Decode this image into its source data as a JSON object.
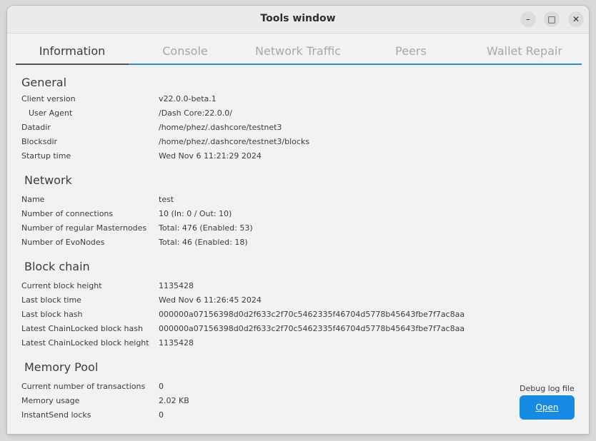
{
  "window": {
    "title": "Tools window",
    "minimize_glyph": "–",
    "maximize_glyph": "□",
    "close_glyph": "✕"
  },
  "tabs": [
    {
      "label": "Information",
      "active": true
    },
    {
      "label": "Console",
      "active": false
    },
    {
      "label": "Network Traffic",
      "active": false
    },
    {
      "label": "Peers",
      "active": false
    },
    {
      "label": "Wallet Repair",
      "active": false
    }
  ],
  "general": {
    "title": "General",
    "rows": [
      {
        "label": "Client version",
        "value": "v22.0.0-beta.1"
      },
      {
        "label": "User Agent",
        "value": "/Dash Core:22.0.0/"
      },
      {
        "label": "Datadir",
        "value": "/home/phez/.dashcore/testnet3"
      },
      {
        "label": "Blocksdir",
        "value": "/home/phez/.dashcore/testnet3/blocks"
      },
      {
        "label": "Startup time",
        "value": "Wed Nov 6 11:21:29 2024"
      }
    ]
  },
  "network": {
    "title": "Network",
    "rows": [
      {
        "label": "Name",
        "value": "test"
      },
      {
        "label": "Number of connections",
        "value": "10 (In: 0 / Out: 10)"
      },
      {
        "label": "Number of regular Masternodes",
        "value": "Total: 476 (Enabled: 53)"
      },
      {
        "label": "Number of EvoNodes",
        "value": "Total: 46 (Enabled: 18)"
      }
    ]
  },
  "blockchain": {
    "title": "Block chain",
    "rows": [
      {
        "label": "Current block height",
        "value": "1135428"
      },
      {
        "label": "Last block time",
        "value": "Wed Nov 6 11:26:45 2024"
      },
      {
        "label": "Last block hash",
        "value": "000000a07156398d0d2f633c2f70c5462335f46704d5778b45643fbe7f7ac8aa"
      },
      {
        "label": "Latest ChainLocked block hash",
        "value": "000000a07156398d0d2f633c2f70c5462335f46704d5778b45643fbe7f7ac8aa"
      },
      {
        "label": "Latest ChainLocked block height",
        "value": "1135428"
      }
    ]
  },
  "mempool": {
    "title": "Memory Pool",
    "rows": [
      {
        "label": "Current number of transactions",
        "value": "0"
      },
      {
        "label": "Memory usage",
        "value": "2.02 KB"
      },
      {
        "label": "InstantSend locks",
        "value": "0"
      }
    ]
  },
  "debug": {
    "label": "Debug log file",
    "button_label": "Open"
  },
  "colors": {
    "accent": "#168be6",
    "tab_underline": "#2b8ed6"
  }
}
